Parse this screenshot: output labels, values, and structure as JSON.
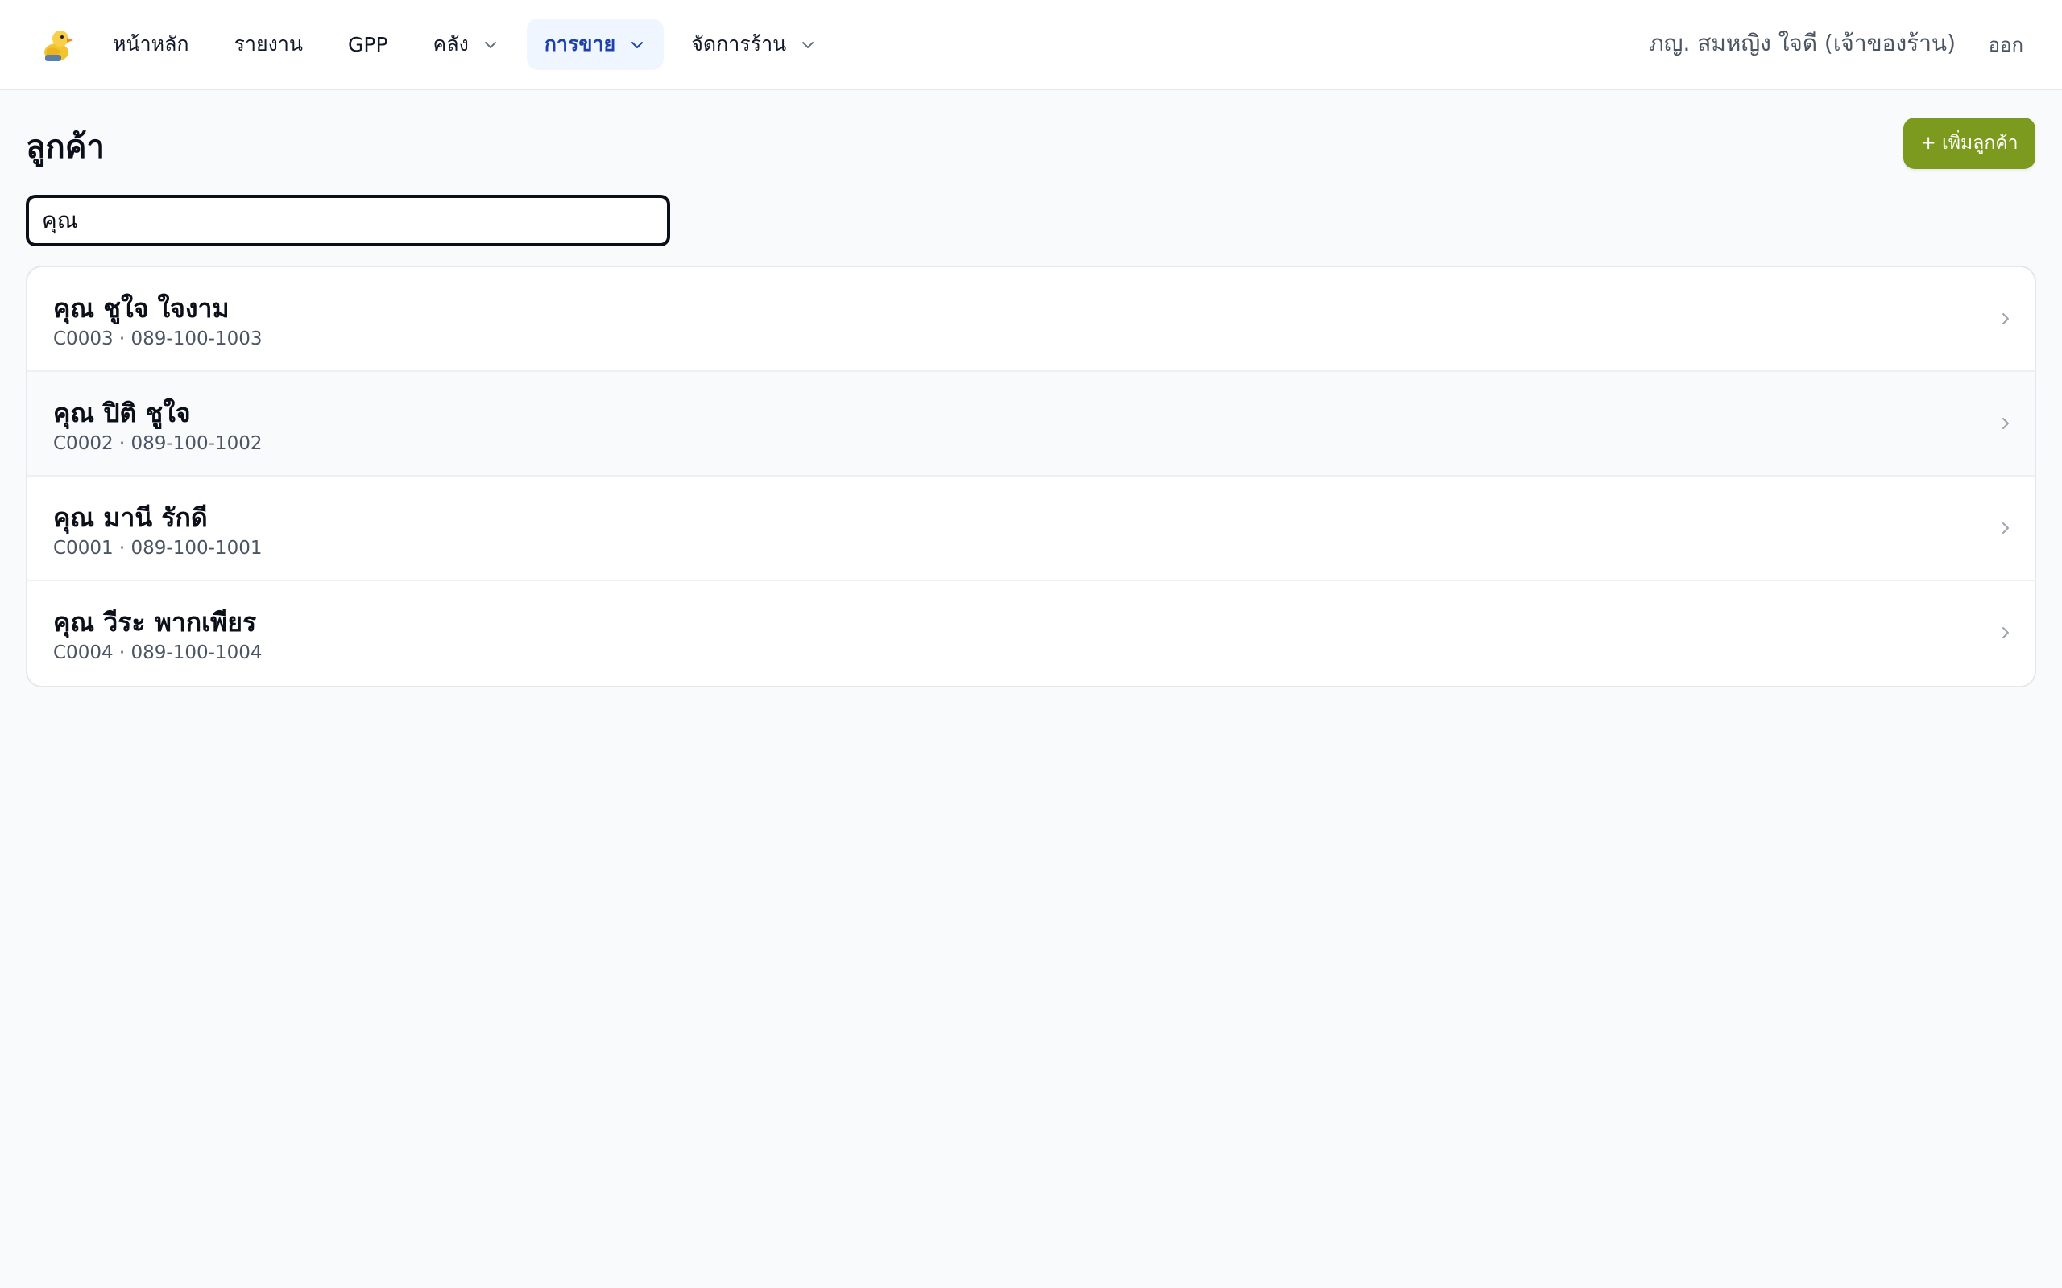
{
  "nav": {
    "items": [
      {
        "label": "หน้าหลัก",
        "has_dropdown": false,
        "active": false
      },
      {
        "label": "รายงาน",
        "has_dropdown": false,
        "active": false
      },
      {
        "label": "GPP",
        "has_dropdown": false,
        "active": false
      },
      {
        "label": "คลัง",
        "has_dropdown": true,
        "active": false
      },
      {
        "label": "การขาย",
        "has_dropdown": true,
        "active": true
      },
      {
        "label": "จัดการร้าน",
        "has_dropdown": true,
        "active": false
      }
    ],
    "user_name": "ภญ. สมหญิง ใจดี (เจ้าของร้าน)",
    "logout_label": "ออก"
  },
  "page": {
    "title": "ลูกค้า",
    "add_button_label": "+ เพิ่มลูกค้า"
  },
  "search": {
    "value": "คุณ"
  },
  "customers": [
    {
      "name": "คุณ ชูใจ ใจงาม",
      "code": "C0003",
      "phone": "089-100-1003"
    },
    {
      "name": "คุณ ปิติ ชูใจ",
      "code": "C0002",
      "phone": "089-100-1002"
    },
    {
      "name": "คุณ มานี รักดี",
      "code": "C0001",
      "phone": "089-100-1001"
    },
    {
      "name": "คุณ วีระ พากเพียร",
      "code": "C0004",
      "phone": "089-100-1004"
    }
  ],
  "colors": {
    "accent_button": "#7c9a1e",
    "active_nav_bg": "#eff6ff",
    "active_nav_text": "#1e40af"
  },
  "icons": {
    "logo": "duck-mascot-icon",
    "dropdown": "chevron-down-icon",
    "row_arrow": "chevron-right-icon"
  }
}
